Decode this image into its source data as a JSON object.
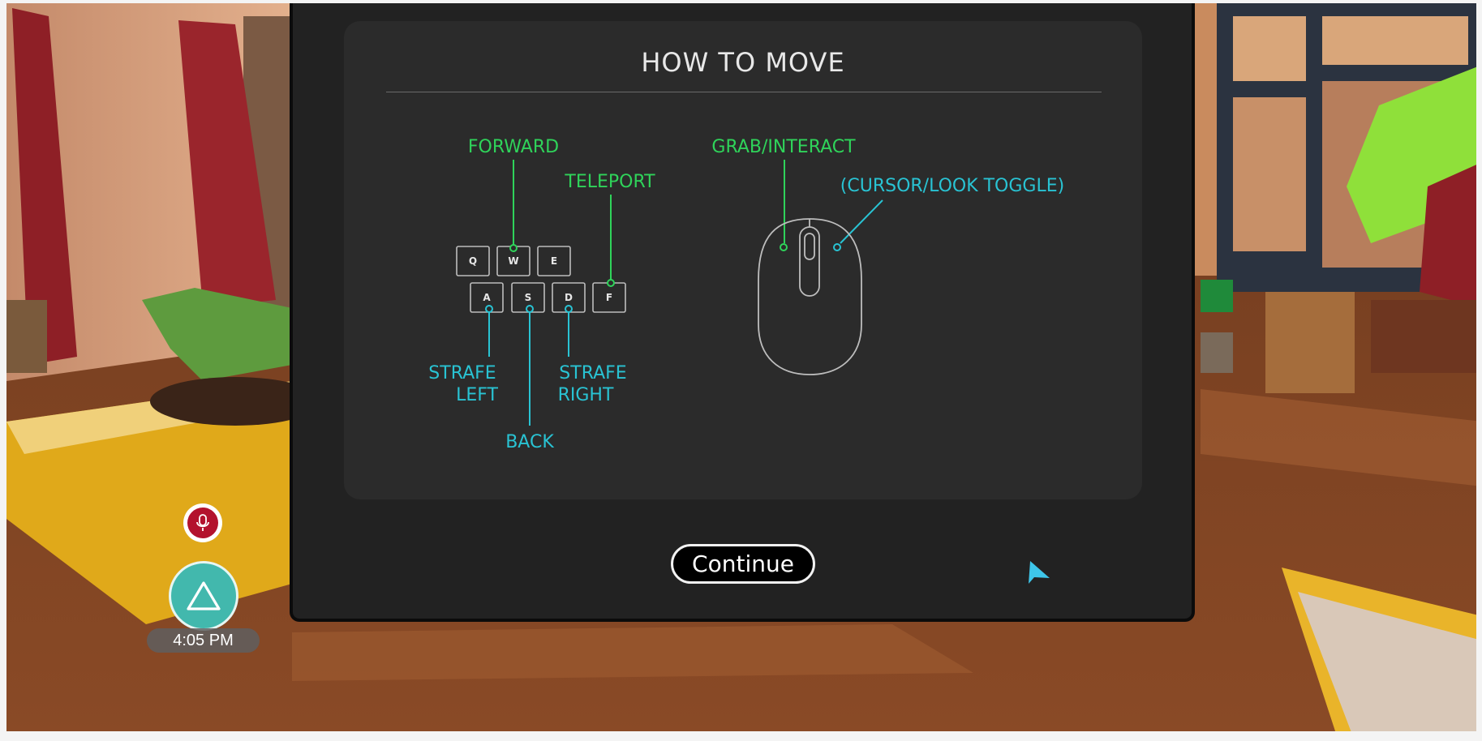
{
  "modal": {
    "title": "HOW TO MOVE",
    "continue_label": "Continue"
  },
  "keyboard": {
    "keys": [
      "Q",
      "W",
      "E",
      "A",
      "S",
      "D",
      "F"
    ],
    "labels": {
      "forward": "FORWARD",
      "teleport": "TELEPORT",
      "strafe_left_1": "STRAFE",
      "strafe_left_2": "LEFT",
      "strafe_right_1": "STRAFE",
      "strafe_right_2": "RIGHT",
      "back": "BACK"
    }
  },
  "mouse": {
    "labels": {
      "left_click": "GRAB/INTERACT",
      "right_click": "(CURSOR/LOOK TOGGLE)"
    }
  },
  "hud": {
    "clock": "4:05 PM",
    "mic_icon": "microphone-icon",
    "menu_icon": "triangle-menu-icon"
  },
  "colors": {
    "green": "#2fd35a",
    "cyan": "#29c3d3",
    "mic_red": "#b3122d",
    "menu_teal": "#42b8ad"
  }
}
